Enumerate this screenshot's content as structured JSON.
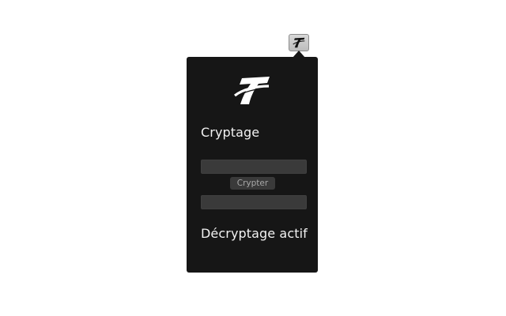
{
  "toolbar": {
    "extension_icon": "stylized-T-logo-icon"
  },
  "popup": {
    "logo_icon": "stylized-T-logo-icon",
    "encrypt_heading": "Cryptage",
    "input_value": "",
    "encrypt_button_label": "Crypter",
    "output_value": "",
    "decrypt_heading": "Décryptage actif"
  },
  "colors": {
    "popup_background": "#161616",
    "field_background": "#3a3a3a",
    "heading_text": "#f2f2f2",
    "button_text": "#a8a8a8"
  }
}
